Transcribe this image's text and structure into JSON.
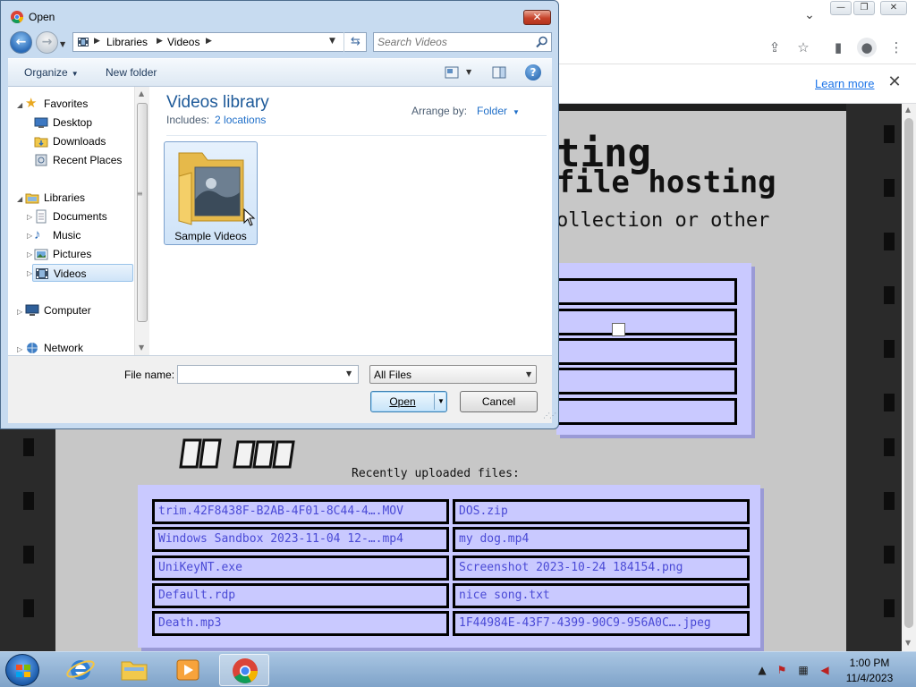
{
  "browser": {
    "window_buttons": {
      "minimize": "—",
      "maximize": "❐",
      "close": "✕"
    },
    "infobar": {
      "learn_more": "Learn more",
      "close": "✕"
    }
  },
  "webpage": {
    "title_line1": "ting",
    "title_line2": "file hosting",
    "title_line3": "ollection or other",
    "recent_title": "Recently uploaded files:",
    "files": [
      [
        "trim.42F8438F-B2AB-4F01-8C44-4….MOV",
        "DOS.zip"
      ],
      [
        "Windows Sandbox 2023-11-04 12-….mp4",
        "my dog.mp4"
      ],
      [
        "UniKeyNT.exe",
        "Screenshot 2023-10-24 184154.png"
      ],
      [
        "Default.rdp",
        "nice song.txt"
      ],
      [
        "Death.mp3",
        "1F44984E-43F7-4399-90C9-956A0C….jpeg"
      ]
    ]
  },
  "dialog": {
    "title": "Open",
    "breadcrumbs": [
      "Libraries",
      "Videos"
    ],
    "search_placeholder": "Search Videos",
    "toolbar": {
      "organize": "Organize",
      "new_folder": "New folder"
    },
    "nav": {
      "favorites": "Favorites",
      "desktop": "Desktop",
      "downloads": "Downloads",
      "recent_places": "Recent Places",
      "libraries": "Libraries",
      "documents": "Documents",
      "music": "Music",
      "pictures": "Pictures",
      "videos": "Videos",
      "computer": "Computer",
      "network": "Network"
    },
    "library": {
      "title": "Videos library",
      "includes_label": "Includes:",
      "includes_link": "2 locations",
      "arrange_label": "Arrange by:",
      "arrange_value": "Folder"
    },
    "items": [
      {
        "name": "Sample Videos"
      }
    ],
    "filename_label": "File name:",
    "filename_value": "",
    "filter": "All Files",
    "open_button": "Open",
    "cancel_button": "Cancel"
  },
  "taskbar": {
    "clock_time": "1:00 PM",
    "clock_date": "11/4/2023"
  }
}
